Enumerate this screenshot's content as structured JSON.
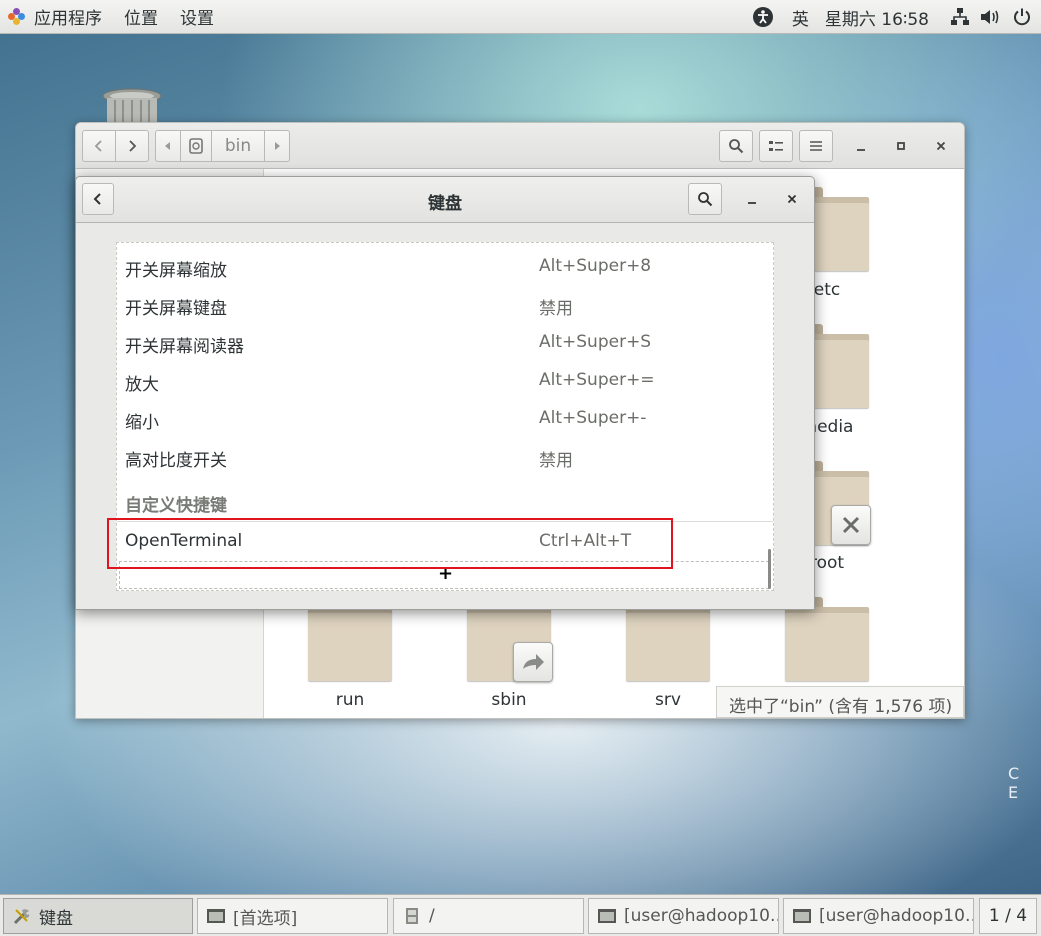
{
  "topbar": {
    "applications": "应用程序",
    "places": "位置",
    "settings": "设置",
    "input_method": "英",
    "clock": "星期六 16∶58"
  },
  "file_manager": {
    "path_current": "bin",
    "folders": [
      {
        "label": "etc"
      },
      {
        "label": "media"
      },
      {
        "label": "root"
      },
      {
        "label": "run"
      },
      {
        "label": "sbin"
      },
      {
        "label": "srv"
      },
      {
        "label": ""
      }
    ],
    "status": "选中了“bin” (含有 1,576 项)"
  },
  "keyboard_dialog": {
    "title": "键盘",
    "shortcuts": [
      {
        "name": "开关屏幕缩放",
        "accel": "Alt+Super+8"
      },
      {
        "name": "开关屏幕键盘",
        "accel": "禁用"
      },
      {
        "name": "开关屏幕阅读器",
        "accel": "Alt+Super+S"
      },
      {
        "name": "放大",
        "accel": "Alt+Super+="
      },
      {
        "name": "缩小",
        "accel": "Alt+Super+-"
      },
      {
        "name": "高对比度开关",
        "accel": "禁用"
      }
    ],
    "custom_section": "自定义快捷键",
    "custom_shortcuts": [
      {
        "name": "OpenTerminal",
        "accel": "Ctrl+Alt+T"
      }
    ],
    "add_label": "+"
  },
  "desktop": {
    "corner_text": "C E"
  },
  "taskbar": {
    "tasks": [
      {
        "label": "键盘",
        "active": true,
        "icon": "settings-tool-icon"
      },
      {
        "label": "[首选项]",
        "active": false,
        "icon": "window-icon"
      },
      {
        "label": "/",
        "active": false,
        "icon": "file-cabinet-icon"
      },
      {
        "label": "[user@hadoop10…",
        "active": false,
        "icon": "terminal-icon"
      },
      {
        "label": "[user@hadoop10…",
        "active": false,
        "icon": "terminal-icon"
      }
    ],
    "pager": "1 / 4"
  },
  "colors": {
    "highlight_border": "#e0141e",
    "folder_fill": "#ded3bf"
  }
}
